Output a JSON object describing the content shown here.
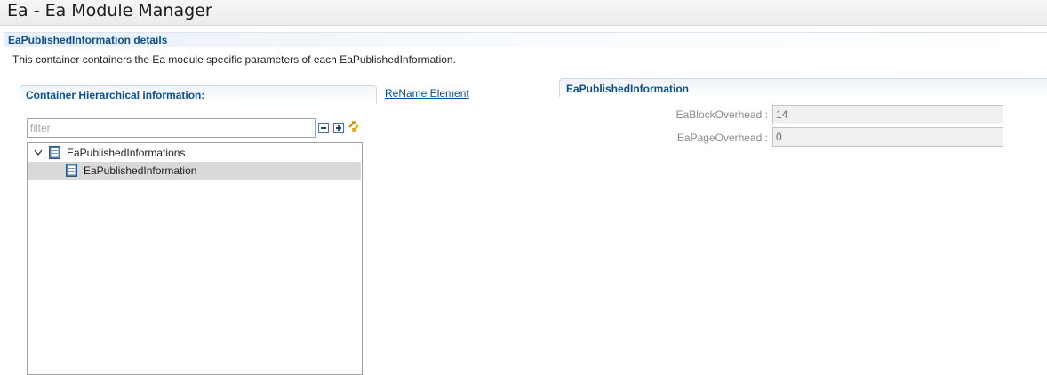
{
  "window": {
    "title": "Ea - Ea Module Manager"
  },
  "details": {
    "title": "EaPublishedInformation details",
    "description": "This container containers the Ea module specific parameters of each EaPublishedInformation."
  },
  "hierarchy": {
    "title": "Container Hierarchical information:",
    "filter_placeholder": "filter",
    "filter_value": "",
    "toolbar": {
      "collapse_icon": "collapse-all-icon",
      "expand_icon": "expand-all-icon",
      "sync_icon": "link-with-editor-icon"
    },
    "tree": {
      "parent": {
        "label": "EaPublishedInformations",
        "expanded": true,
        "icon": "container-icon"
      },
      "child": {
        "label": "EaPublishedInformation",
        "selected": true,
        "icon": "container-icon"
      }
    }
  },
  "rename_link": "ReName Element",
  "parameters": {
    "title": "EaPublishedInformation",
    "fields": [
      {
        "label": "EaBlockOverhead :",
        "value": "14"
      },
      {
        "label": "EaPageOverhead :",
        "value": "0"
      }
    ]
  },
  "colors": {
    "heading_blue": "#0a4f8f",
    "selection_gray": "#d9d9d9",
    "readonly_field": "#f0f0f0"
  }
}
